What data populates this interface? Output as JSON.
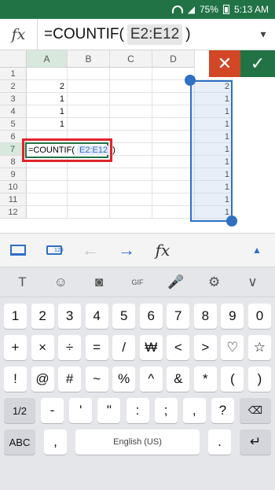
{
  "status": {
    "battery": "75%",
    "time": "5:13 AM"
  },
  "formula_bar": {
    "fx_label": "fx",
    "prefix": "=COUNTIF(",
    "range": "E2:E12",
    "suffix": ")",
    "dropdown_icon": "chevron-down-icon"
  },
  "sheet": {
    "columns": [
      "A",
      "B",
      "C",
      "D"
    ],
    "rows": [
      "1",
      "2",
      "3",
      "4",
      "5",
      "6",
      "7",
      "8",
      "9",
      "10",
      "11",
      "12"
    ],
    "column_a_values": [
      "",
      "2",
      "1",
      "1",
      "1",
      "",
      "",
      "",
      "",
      "",
      "",
      ""
    ],
    "column_e_values": [
      "",
      "2",
      "1",
      "1",
      "1",
      "1",
      "1",
      "1",
      "1",
      "1",
      "1",
      "1"
    ],
    "active_row": "7",
    "active_column": "A",
    "edit_cell": {
      "prefix": "=COUNTIF(",
      "range": "E2:E12",
      "suffix": ")"
    }
  },
  "actions": {
    "cancel": "✕",
    "confirm": "✓"
  },
  "toolbar": {
    "fx_label": "fx",
    "kbd_tag": "123",
    "expand": "▲"
  },
  "keyboard": {
    "suggest_icons": [
      "translate-icon",
      "emoji-icon",
      "sticker-icon",
      "gif-icon",
      "mic-icon",
      "settings-icon",
      "chevron-down-icon"
    ],
    "suggest_glyphs": [
      "T",
      "☺",
      "◙",
      "GIF",
      "🎤",
      "⚙",
      "∨"
    ],
    "row1": [
      "1",
      "2",
      "3",
      "4",
      "5",
      "6",
      "7",
      "8",
      "9",
      "0"
    ],
    "row2": [
      "+",
      "×",
      "÷",
      "=",
      "/",
      "₩",
      "<",
      ">",
      "♡",
      "☆"
    ],
    "row3": [
      "!",
      "@",
      "#",
      "~",
      "%",
      "^",
      "&",
      "*",
      "(",
      ")"
    ],
    "row4": [
      "1/2",
      "-",
      "'",
      "\"",
      ":",
      ";",
      ",",
      "?",
      "⌫"
    ],
    "row5": {
      "abc": "ABC",
      "comma": ",",
      "space": "English (US)",
      "dot": ".",
      "enter": "↵"
    }
  }
}
